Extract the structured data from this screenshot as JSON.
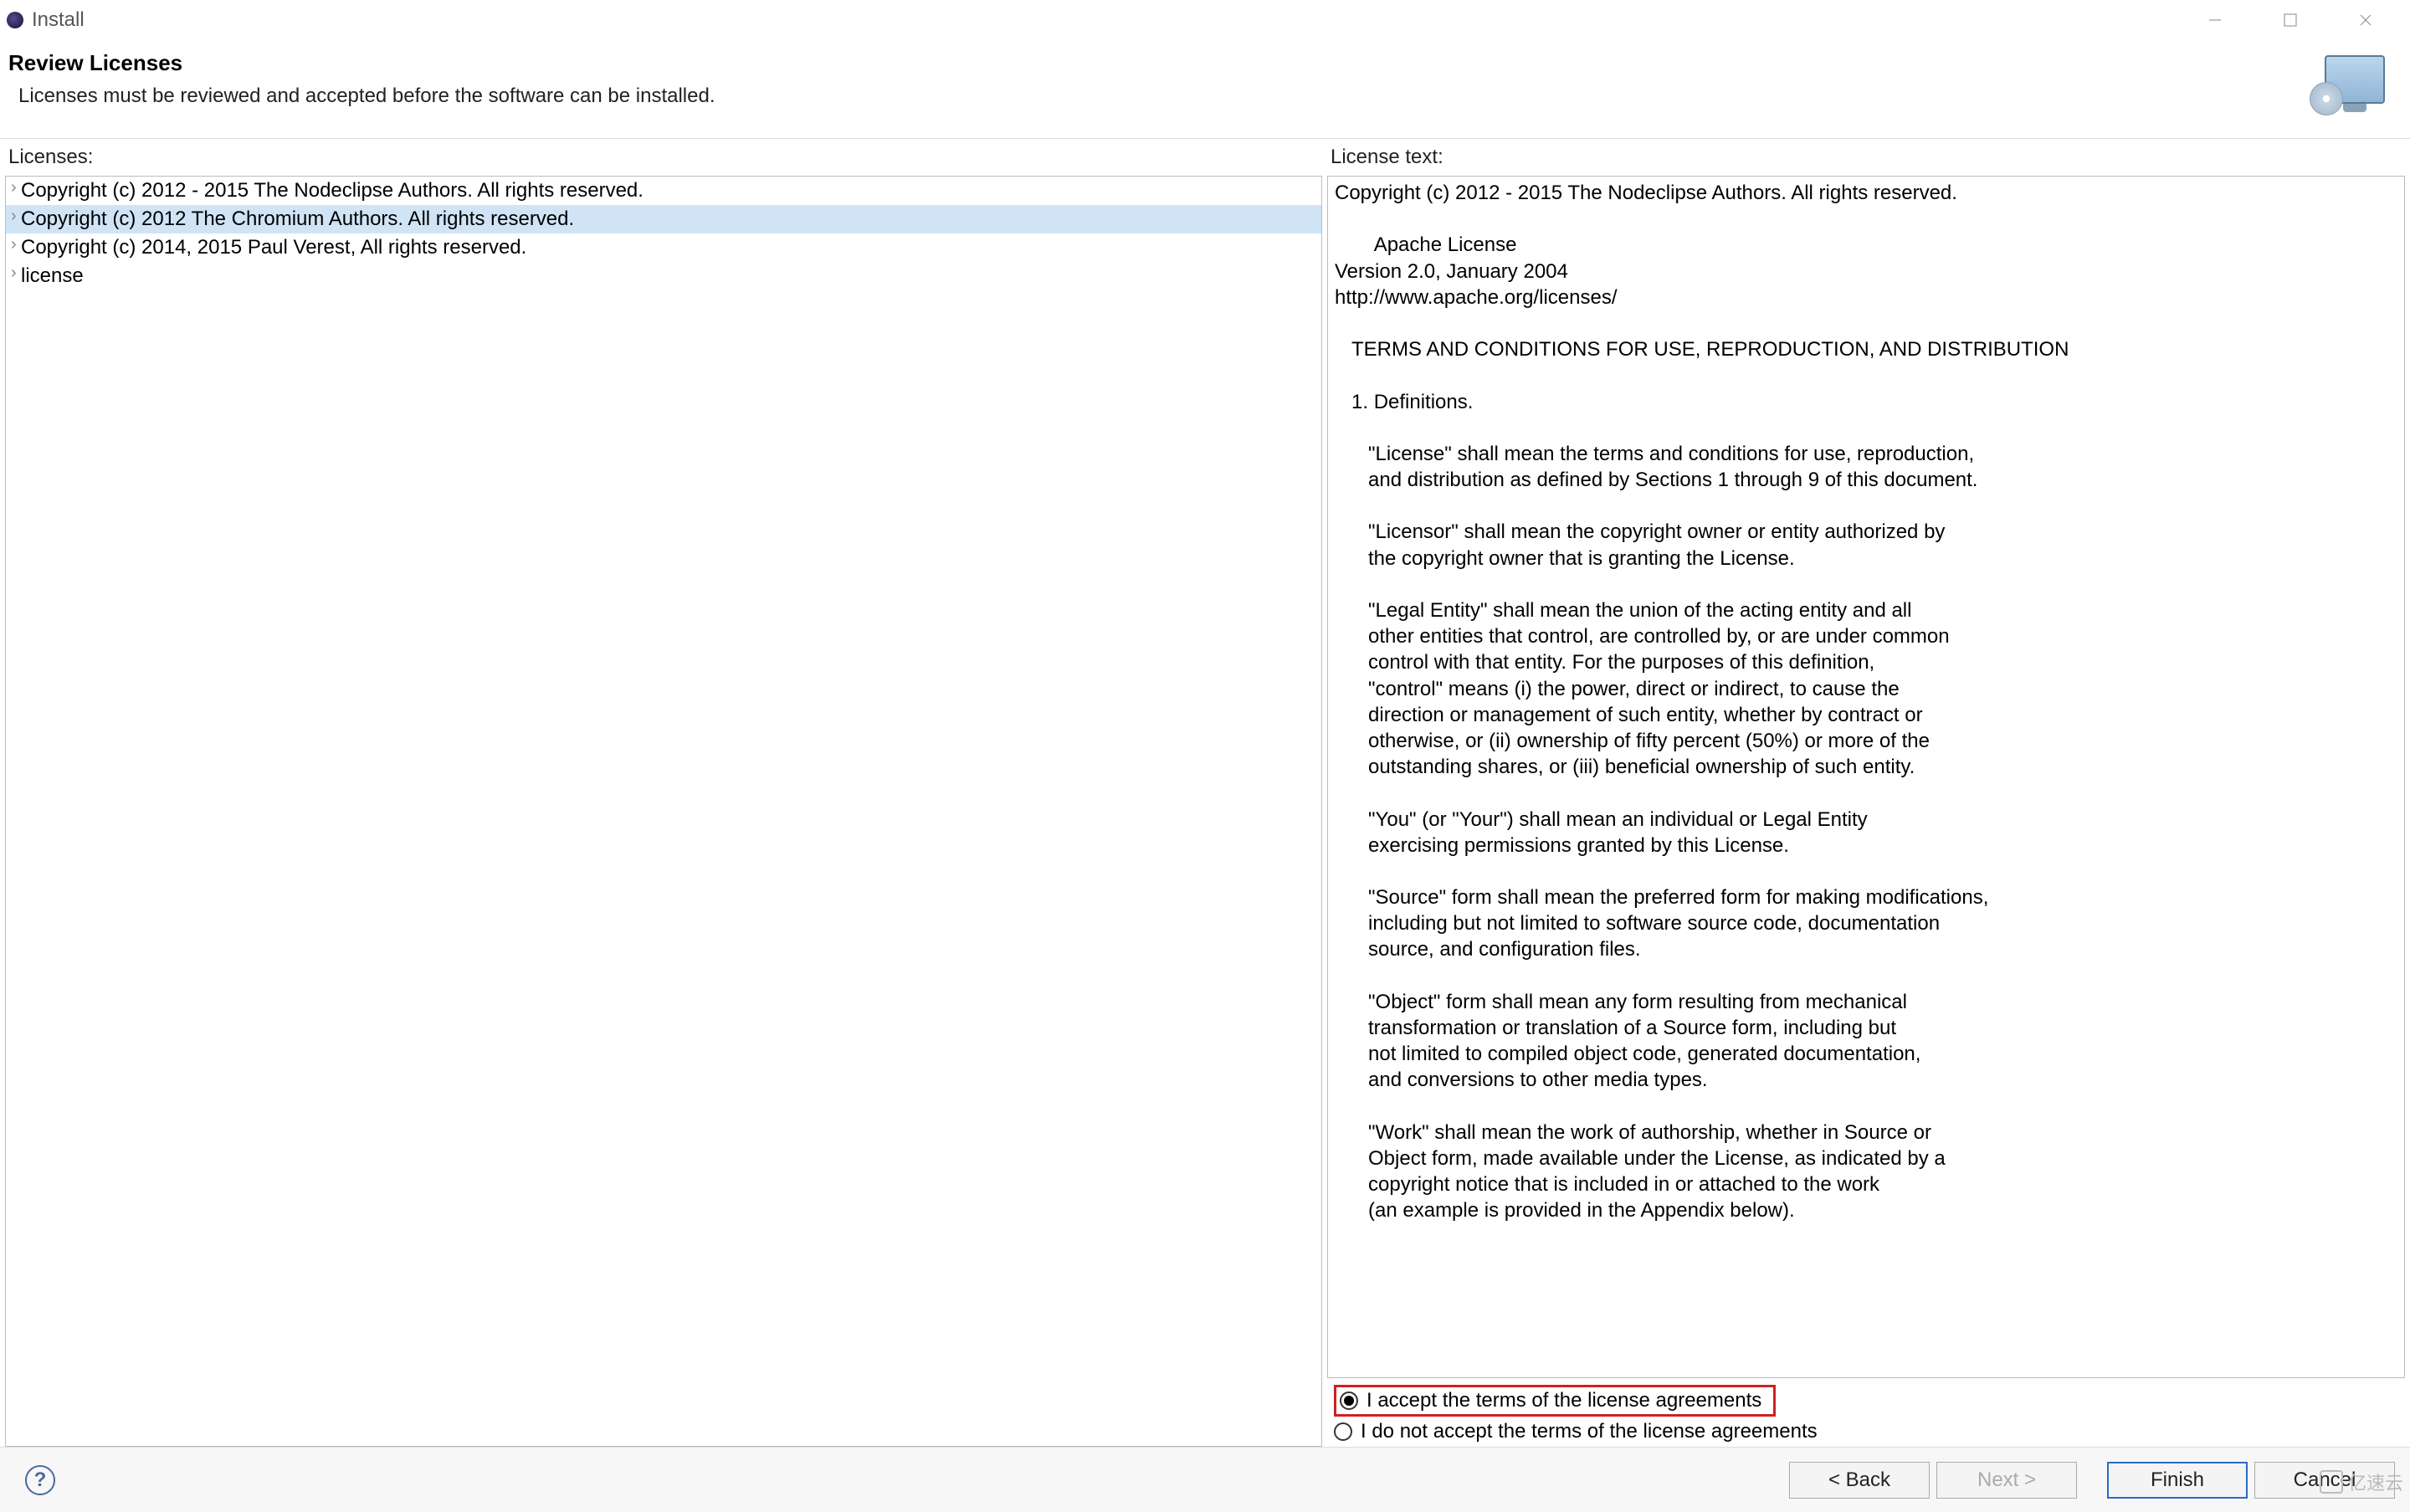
{
  "window": {
    "title": "Install"
  },
  "header": {
    "title": "Review Licenses",
    "description": "Licenses must be reviewed and accepted before the software can be installed."
  },
  "panes": {
    "licenses_label": "Licenses:",
    "license_text_label": "License text:"
  },
  "licenses": [
    {
      "label": "Copyright (c) 2012 - 2015 The Nodeclipse Authors. All rights reserved.",
      "selected": false
    },
    {
      "label": "Copyright (c) 2012 The Chromium Authors. All rights reserved.",
      "selected": true
    },
    {
      "label": "Copyright (c) 2014, 2015 Paul Verest, All rights reserved.",
      "selected": false
    },
    {
      "label": "license",
      "selected": false
    }
  ],
  "license_text": "Copyright (c) 2012 - 2015 The Nodeclipse Authors. All rights reserved.\n\n       Apache License\nVersion 2.0, January 2004\nhttp://www.apache.org/licenses/\n\n   TERMS AND CONDITIONS FOR USE, REPRODUCTION, AND DISTRIBUTION\n\n   1. Definitions.\n\n      \"License\" shall mean the terms and conditions for use, reproduction,\n      and distribution as defined by Sections 1 through 9 of this document.\n\n      \"Licensor\" shall mean the copyright owner or entity authorized by\n      the copyright owner that is granting the License.\n\n      \"Legal Entity\" shall mean the union of the acting entity and all\n      other entities that control, are controlled by, or are under common\n      control with that entity. For the purposes of this definition,\n      \"control\" means (i) the power, direct or indirect, to cause the\n      direction or management of such entity, whether by contract or\n      otherwise, or (ii) ownership of fifty percent (50%) or more of the\n      outstanding shares, or (iii) beneficial ownership of such entity.\n\n      \"You\" (or \"Your\") shall mean an individual or Legal Entity\n      exercising permissions granted by this License.\n\n      \"Source\" form shall mean the preferred form for making modifications,\n      including but not limited to software source code, documentation\n      source, and configuration files.\n\n      \"Object\" form shall mean any form resulting from mechanical\n      transformation or translation of a Source form, including but\n      not limited to compiled object code, generated documentation,\n      and conversions to other media types.\n\n      \"Work\" shall mean the work of authorship, whether in Source or\n      Object form, made available under the License, as indicated by a\n      copyright notice that is included in or attached to the work\n      (an example is provided in the Appendix below).\n",
  "radios": {
    "accept": "I accept the terms of the license agreements",
    "decline": "I do not accept the terms of the license agreements",
    "selected": "accept"
  },
  "buttons": {
    "back": "< Back",
    "next": "Next >",
    "finish": "Finish",
    "cancel": "Cancel"
  },
  "watermark": "亿速云"
}
